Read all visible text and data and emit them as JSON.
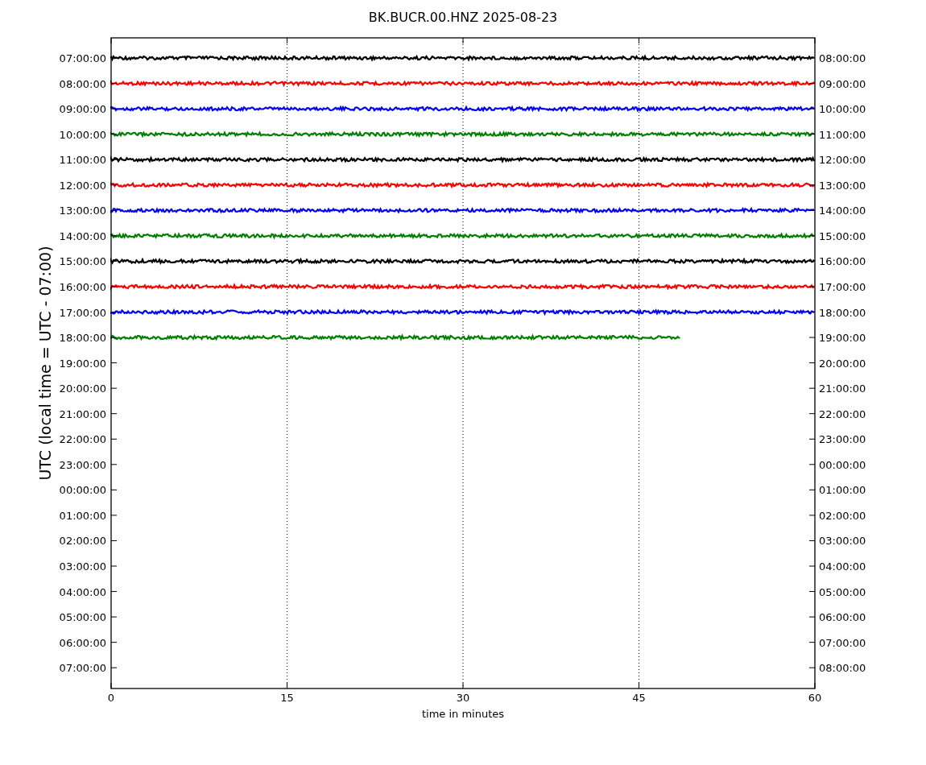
{
  "plot": {
    "title": "BK.BUCR.00.HNZ 2025-08-23",
    "ylabel": "UTC (local time = UTC - 07:00)",
    "xlabel": "time in minutes",
    "xticks": [
      "0",
      "15",
      "30",
      "45",
      "60"
    ],
    "left_labels": [
      "07:00:00",
      "08:00:00",
      "09:00:00",
      "10:00:00",
      "11:00:00",
      "12:00:00",
      "13:00:00",
      "14:00:00",
      "15:00:00",
      "16:00:00",
      "17:00:00",
      "18:00:00",
      "19:00:00",
      "20:00:00",
      "21:00:00",
      "22:00:00",
      "23:00:00",
      "00:00:00",
      "01:00:00",
      "02:00:00",
      "03:00:00",
      "04:00:00",
      "05:00:00",
      "06:00:00",
      "07:00:00"
    ],
    "right_labels": [
      "08:00:00",
      "09:00:00",
      "10:00:00",
      "11:00:00",
      "12:00:00",
      "13:00:00",
      "14:00:00",
      "15:00:00",
      "16:00:00",
      "17:00:00",
      "18:00:00",
      "19:00:00",
      "20:00:00",
      "21:00:00",
      "22:00:00",
      "23:00:00",
      "00:00:00",
      "01:00:00",
      "02:00:00",
      "03:00:00",
      "04:00:00",
      "05:00:00",
      "06:00:00",
      "07:00:00",
      "08:00:00"
    ],
    "traces": [
      {
        "color": "#000000",
        "level": 1
      },
      {
        "color": "#ff0000",
        "level": 1
      },
      {
        "color": "#0000ff",
        "level": 1
      },
      {
        "color": "#008000",
        "level": 1
      },
      {
        "color": "#000000",
        "level": 1
      },
      {
        "color": "#ff0000",
        "level": 1
      },
      {
        "color": "#0000ff",
        "level": 1
      },
      {
        "color": "#008000",
        "level": 1
      },
      {
        "color": "#000000",
        "level": 1
      },
      {
        "color": "#ff0000",
        "level": 1
      },
      {
        "color": "#0000ff",
        "level": 1
      },
      {
        "color": "#008000",
        "level": 0.81
      }
    ]
  }
}
